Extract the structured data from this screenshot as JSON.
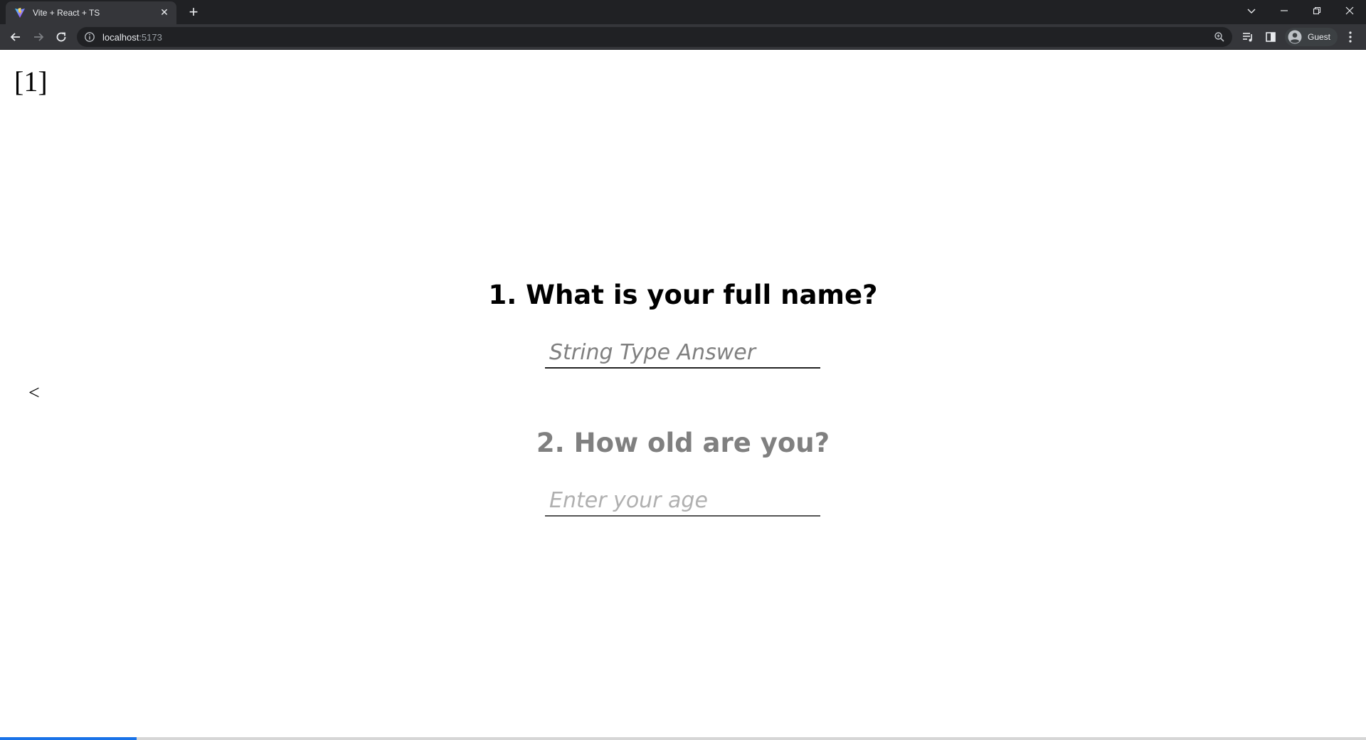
{
  "browser": {
    "tab": {
      "title": "Vite + React + TS",
      "close_glyph": "✕"
    },
    "new_tab_glyph": "+",
    "address": {
      "host": "localhost",
      "port": ":5173"
    },
    "profile": {
      "label": "Guest"
    },
    "window_controls": {
      "minimize": "—",
      "restore": "❐",
      "close": "✕",
      "tab_search": "⌄"
    }
  },
  "page": {
    "index_label": "[1]",
    "back_label": "<",
    "questions": [
      {
        "label": "1. What is your full name?",
        "placeholder": "String Type Answer"
      },
      {
        "label": "2. How old are you?",
        "placeholder": "Enter your age"
      }
    ],
    "progress": {
      "fraction": 0.1,
      "color": "#1a73e8"
    }
  },
  "icons": {
    "favicon": "vite-logo-icon",
    "back": "arrow-left-icon",
    "forward": "arrow-right-icon",
    "reload": "reload-icon",
    "site_info": "info-icon",
    "zoom": "zoom-icon",
    "media": "media-control-icon",
    "side_panel": "side-panel-icon",
    "avatar": "avatar-icon",
    "menu": "kebab-menu-icon"
  }
}
